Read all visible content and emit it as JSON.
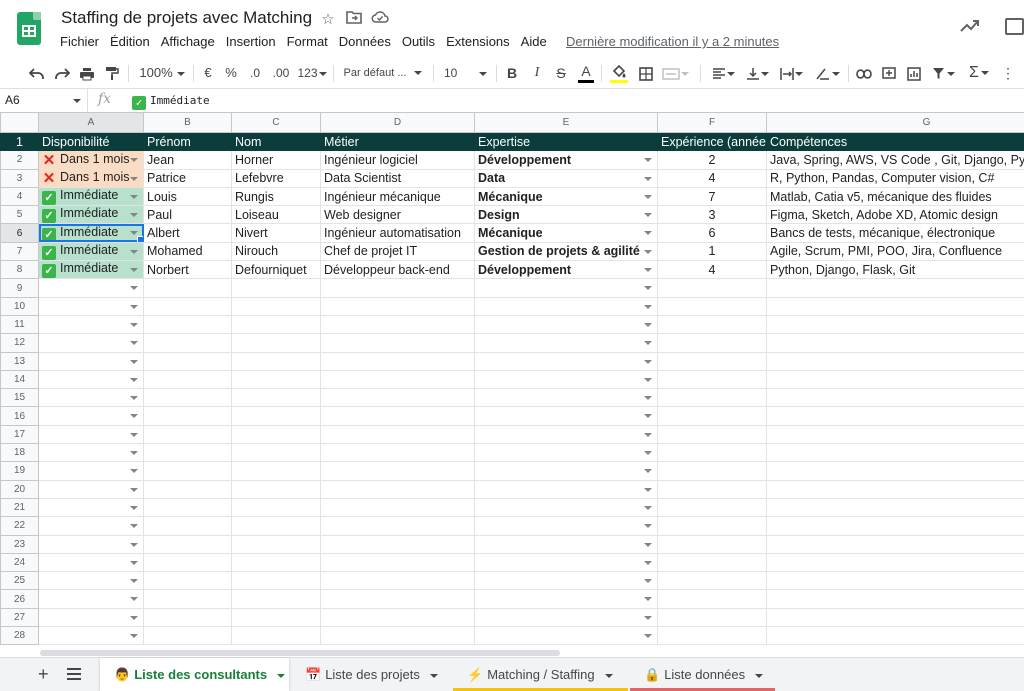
{
  "doc": {
    "title": "Staffing de projets avec Matching",
    "menus": [
      "Fichier",
      "Édition",
      "Affichage",
      "Insertion",
      "Format",
      "Données",
      "Outils",
      "Extensions",
      "Aide"
    ],
    "last_edit": "Dernière modification il y a 2 minutes"
  },
  "toolbar": {
    "zoom": "100%",
    "currency": "€",
    "percent": "%",
    "dec_decrease": ".0",
    "dec_increase": ".00",
    "more_formats": "123",
    "font": "Par défaut ...",
    "font_size": "10",
    "bold": "B",
    "italic": "I",
    "strike": "S",
    "text_color": "A",
    "text_color_hex": "#000000",
    "fill_color_hex": "#ffff00"
  },
  "formula_bar": {
    "cell_ref": "A6",
    "fx": "fx",
    "value": "Immédiate"
  },
  "colors": {
    "header_bg": "#0b3d3d",
    "available_bg": "#b7e1cd",
    "later_bg": "#fbdcc3",
    "selection": "#1a73e8",
    "active_tab": "#188038"
  },
  "grid": {
    "col_letters": [
      "A",
      "B",
      "C",
      "D",
      "E",
      "F",
      "G"
    ],
    "headers": [
      "Disponibilité",
      "Prénom",
      "Nom",
      "Métier",
      "Expertise",
      "Expérience (années)",
      "Compétences"
    ],
    "rows": [
      {
        "status": "later",
        "availability": "Dans 1 mois",
        "first": "Jean",
        "last": "Horner",
        "job": "Ingénieur logiciel",
        "expertise": "Développement",
        "exp": "2",
        "skills": "Java, Spring, AWS, VS Code , Git, Django, Python"
      },
      {
        "status": "later",
        "availability": "Dans 1 mois",
        "first": "Patrice",
        "last": "Lefebvre",
        "job": "Data Scientist",
        "expertise": "Data",
        "exp": "4",
        "skills": "R, Python, Pandas, Computer vision, C#"
      },
      {
        "status": "now",
        "availability": "Immédiate",
        "first": "Louis",
        "last": "Rungis",
        "job": "Ingénieur mécanique",
        "expertise": "Mécanique",
        "exp": "7",
        "skills": "Matlab, Catia v5, mécanique des fluides"
      },
      {
        "status": "now",
        "availability": "Immédiate",
        "first": "Paul",
        "last": "Loiseau",
        "job": "Web designer",
        "expertise": "Design",
        "exp": "3",
        "skills": "Figma, Sketch, Adobe XD, Atomic design"
      },
      {
        "status": "now",
        "availability": "Immédiate",
        "first": "Albert",
        "last": "Nivert",
        "job": "Ingénieur automatisation",
        "expertise": "Mécanique",
        "exp": "6",
        "skills": "Bancs de tests, mécanique, électronique"
      },
      {
        "status": "now",
        "availability": "Immédiate",
        "first": "Mohamed",
        "last": "Nirouch",
        "job": "Chef de projet IT",
        "expertise": "Gestion de projets & agilité",
        "exp": "1",
        "skills": "Agile, Scrum, PMI, POO, Jira, Confluence"
      },
      {
        "status": "now",
        "availability": "Immédiate",
        "first": "Norbert",
        "last": "Defourniquet",
        "job": "Développeur back-end",
        "expertise": "Développement",
        "exp": "4",
        "skills": "Python, Django, Flask, Git"
      }
    ],
    "row_numbers": [
      "1",
      "2",
      "3",
      "4",
      "5",
      "6",
      "7",
      "8",
      "9",
      "10",
      "11",
      "12",
      "13",
      "14",
      "15",
      "16",
      "17",
      "18",
      "19",
      "20",
      "21",
      "22",
      "23",
      "24",
      "25",
      "26",
      "27",
      "28"
    ],
    "selected_row": "6"
  },
  "sheets": [
    {
      "emoji": "👨",
      "label": "Liste des consultants",
      "active": true,
      "color": ""
    },
    {
      "emoji": "📅",
      "label": "Liste des projets",
      "active": false,
      "color": ""
    },
    {
      "emoji": "⚡",
      "label": "Matching / Staffing",
      "active": false,
      "color": "#f4c20d"
    },
    {
      "emoji": "🔒",
      "label": "Liste données",
      "active": false,
      "color": "#e06666"
    }
  ]
}
